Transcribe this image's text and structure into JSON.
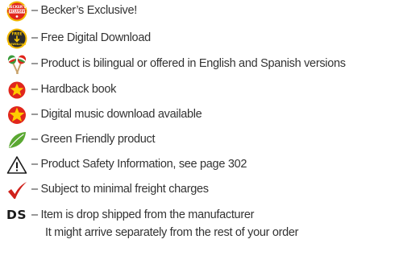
{
  "legend": {
    "items": [
      {
        "icon": "beckers-exclusive-badge-icon",
        "badge_text": "BECKER'S EXCLUSIVE",
        "text": "– Becker’s Exclusive!"
      },
      {
        "icon": "free-download-badge-icon",
        "badge_text": "FREE DOWNLOAD",
        "text": "– Free Digital Download"
      },
      {
        "icon": "maracas-icon",
        "text": "– Product is bilingual or offered in English and Spanish versions"
      },
      {
        "icon": "hardback-star-icon",
        "text": "– Hardback book"
      },
      {
        "icon": "music-download-star-icon",
        "text": "– Digital music download available"
      },
      {
        "icon": "leaf-icon",
        "text": "– Green Friendly product"
      },
      {
        "icon": "warning-triangle-icon",
        "text": "– Product Safety Information, see page 302"
      },
      {
        "icon": "checkmark-icon",
        "text": "– Subject to minimal freight charges"
      }
    ],
    "drop_ship": {
      "code": "DS",
      "line1": "– Item is drop shipped from the manufacturer",
      "line2": "It might arrive separately from the rest of your order"
    }
  },
  "colors": {
    "red": "#e1261c",
    "yellow": "#ffcc00",
    "dark": "#2b2b2b",
    "green": "#5aa832",
    "check_red": "#d0211b"
  }
}
